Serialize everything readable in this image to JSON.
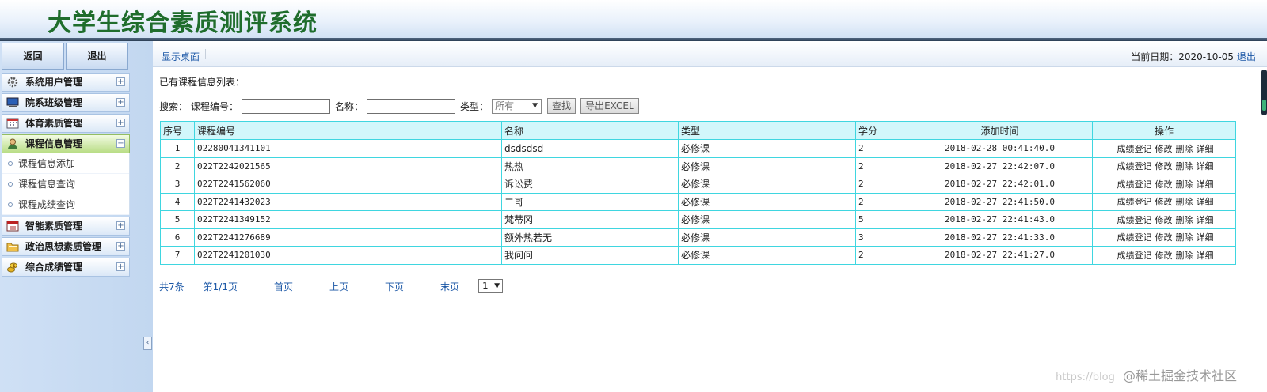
{
  "header": {
    "title": "大学生综合素质测评系统"
  },
  "sidebar": {
    "back_label": "返回",
    "exit_label": "退出",
    "menus": [
      {
        "label": "系统用户管理",
        "icon": "gear-icon",
        "expanded": false
      },
      {
        "label": "院系班级管理",
        "icon": "monitor-icon",
        "expanded": false
      },
      {
        "label": "体育素质管理",
        "icon": "calendar-icon",
        "expanded": false
      },
      {
        "label": "课程信息管理",
        "icon": "user-icon",
        "expanded": true
      },
      {
        "label": "智能素质管理",
        "icon": "calendar-red-icon",
        "expanded": false
      },
      {
        "label": "政治思想素质管理",
        "icon": "folder-icon",
        "expanded": false
      },
      {
        "label": "综合成绩管理",
        "icon": "coins-icon",
        "expanded": false
      }
    ],
    "subitems": [
      {
        "label": "课程信息添加"
      },
      {
        "label": "课程信息查询"
      },
      {
        "label": "课程成绩查询"
      }
    ],
    "plus_symbol": "+",
    "minus_symbol": "−",
    "collapse_symbol": "‹"
  },
  "topbar": {
    "desktop_label": "显示桌面",
    "date_text": "当前日期：2020-10-05",
    "logout_label": "退出"
  },
  "list_title": "已有课程信息列表：",
  "search": {
    "prefix": "搜索：",
    "code_label": "课程编号：",
    "code_value": "",
    "name_label": "名称：",
    "name_value": "",
    "type_label": "类型：",
    "type_value": "所有",
    "find_label": "查找",
    "export_label": "导出EXCEL"
  },
  "table": {
    "headers": [
      "序号",
      "课程编号",
      "名称",
      "类型",
      "学分",
      "添加时间",
      "操作"
    ],
    "rows": [
      {
        "no": "1",
        "code": "02280041341101",
        "name": "dsdsdsd",
        "type": "必修课",
        "credit": "2",
        "time": "2018-02-28 00:41:40.0"
      },
      {
        "no": "2",
        "code": "022T2242021565",
        "name": "热热",
        "type": "必修课",
        "credit": "2",
        "time": "2018-02-27 22:42:07.0"
      },
      {
        "no": "3",
        "code": "022T2241562060",
        "name": "诉讼费",
        "type": "必修课",
        "credit": "2",
        "time": "2018-02-27 22:42:01.0"
      },
      {
        "no": "4",
        "code": "022T2241432023",
        "name": "二哥",
        "type": "必修课",
        "credit": "2",
        "time": "2018-02-27 22:41:50.0"
      },
      {
        "no": "5",
        "code": "022T2241349152",
        "name": "梵蒂冈",
        "type": "必修课",
        "credit": "5",
        "time": "2018-02-27 22:41:43.0"
      },
      {
        "no": "6",
        "code": "022T2241276689",
        "name": "额外热若无",
        "type": "必修课",
        "credit": "3",
        "time": "2018-02-27 22:41:33.0"
      },
      {
        "no": "7",
        "code": "022T2241201030",
        "name": "我问问",
        "type": "必修课",
        "credit": "2",
        "time": "2018-02-27 22:41:27.0"
      }
    ],
    "actions": [
      "成绩登记",
      "修改",
      "删除",
      "详细"
    ]
  },
  "pager": {
    "total": "共7条",
    "page": "第1/1页",
    "first": "首页",
    "prev": "上页",
    "next": "下页",
    "last": "末页",
    "page_select": "1"
  },
  "watermark": {
    "url": "https://blog",
    "brand": "@稀土掘金技术社区"
  },
  "colors": {
    "title_green": "#1f6d2c",
    "link_blue": "#1b57a6",
    "table_border": "#3fd6e0",
    "header_bg": "#d2f7fb",
    "active_menu": "#b9dd86"
  }
}
